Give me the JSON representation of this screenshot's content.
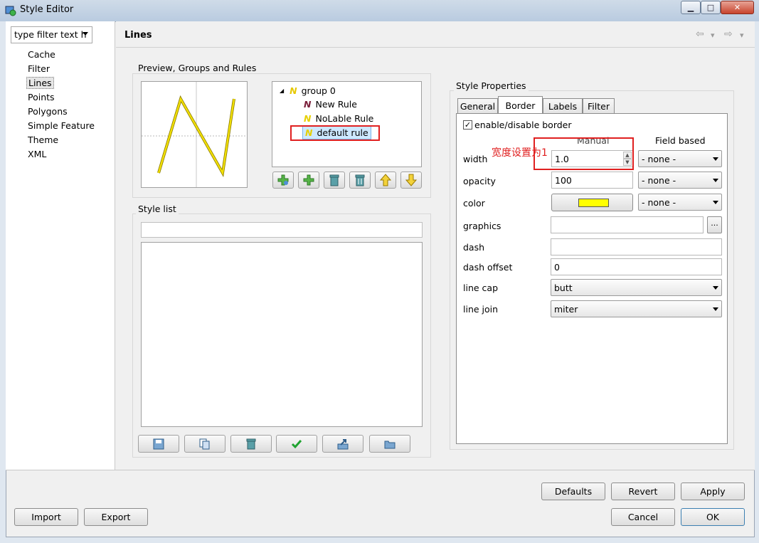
{
  "window": {
    "title": "Style Editor",
    "minimize": "▁",
    "maximize": "□",
    "close": "✕"
  },
  "sidebar": {
    "filter_text": "type filter text h",
    "items": [
      "Cache",
      "Filter",
      "Lines",
      "Points",
      "Polygons",
      "Simple Feature",
      "Theme",
      "XML"
    ],
    "selected": "Lines"
  },
  "page": {
    "title": "Lines",
    "back_icon": "⇦",
    "forward_icon": "⇨",
    "menu_icon": "▾"
  },
  "preview_group": {
    "label": "Preview, Groups and Rules",
    "tree": [
      {
        "label": "group 0",
        "icon": "group-rule-icon"
      },
      {
        "label": "New Rule",
        "icon": "rule-icon-dark"
      },
      {
        "label": "NoLable Rule",
        "icon": "rule-icon-yellow"
      },
      {
        "label": "default rule",
        "icon": "rule-icon-yellow"
      }
    ],
    "buttons": [
      "add-group",
      "add-rule",
      "remove",
      "remove-all",
      "move-up",
      "move-down"
    ]
  },
  "style_list": {
    "label": "Style list",
    "search_value": ""
  },
  "properties": {
    "label": "Style Properties",
    "tabs": [
      "General",
      "Border",
      "Labels",
      "Filter"
    ],
    "active_tab": "Border",
    "enable_border_label": "enable/disable border",
    "enable_border_checked": true,
    "col_manual": "Manual",
    "col_field": "Field based",
    "annotation": "宽度设置为1",
    "rows": {
      "width": {
        "label": "width",
        "value": "1.0",
        "field": "- none -"
      },
      "opacity": {
        "label": "opacity",
        "value": "100",
        "field": "- none -"
      },
      "color": {
        "label": "color",
        "swatch": "#ffff00",
        "field": "- none -"
      },
      "graphics": {
        "label": "graphics",
        "value": "",
        "button": "..."
      },
      "dash": {
        "label": "dash",
        "value": ""
      },
      "dash_offset": {
        "label": "dash offset",
        "value": "0"
      },
      "line_cap": {
        "label": "line cap",
        "value": "butt"
      },
      "line_join": {
        "label": "line join",
        "value": "miter"
      }
    }
  },
  "footer": {
    "defaults": "Defaults",
    "revert": "Revert",
    "apply": "Apply",
    "import": "Import",
    "export": "Export",
    "cancel": "Cancel",
    "ok": "OK"
  },
  "colors": {
    "highlight_box": "#e02020",
    "line_yellow": "#e6d200"
  }
}
